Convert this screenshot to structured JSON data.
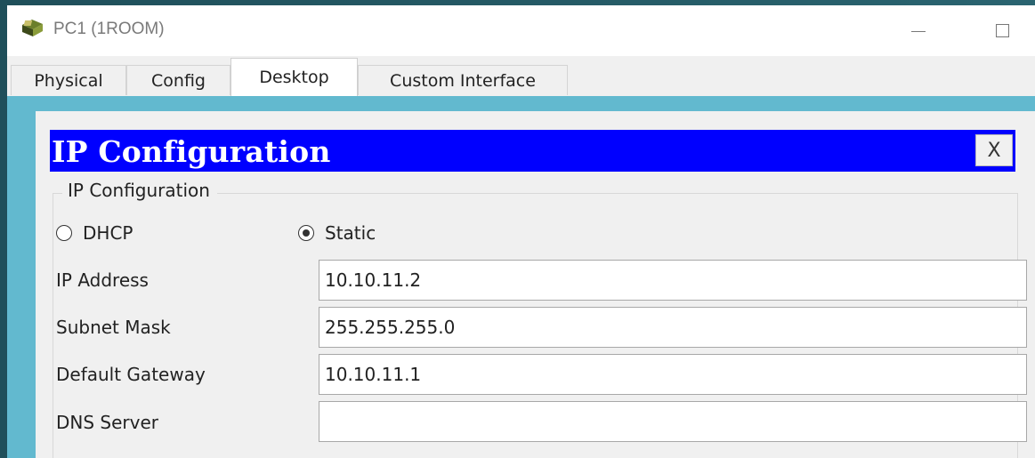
{
  "window": {
    "title": "PC1 (1ROOM)",
    "icon": "computer-icon"
  },
  "tabs": [
    {
      "label": "Physical",
      "active": false
    },
    {
      "label": "Config",
      "active": false
    },
    {
      "label": "Desktop",
      "active": true
    },
    {
      "label": "Custom Interface",
      "active": false
    }
  ],
  "dialog": {
    "title": "IP Configuration",
    "close_label": "X",
    "header_color": "#0000ff"
  },
  "ip_config": {
    "group_label": "IP Configuration",
    "mode_options": [
      {
        "label": "DHCP",
        "selected": false
      },
      {
        "label": "Static",
        "selected": true
      }
    ],
    "fields": [
      {
        "label": "IP Address",
        "value": "10.10.11.2"
      },
      {
        "label": "Subnet Mask",
        "value": "255.255.255.0"
      },
      {
        "label": "Default Gateway",
        "value": "10.10.11.1"
      },
      {
        "label": "DNS Server",
        "value": ""
      }
    ]
  },
  "colors": {
    "content_background": "#62b9cf",
    "panel_background": "#f0f0f0"
  }
}
